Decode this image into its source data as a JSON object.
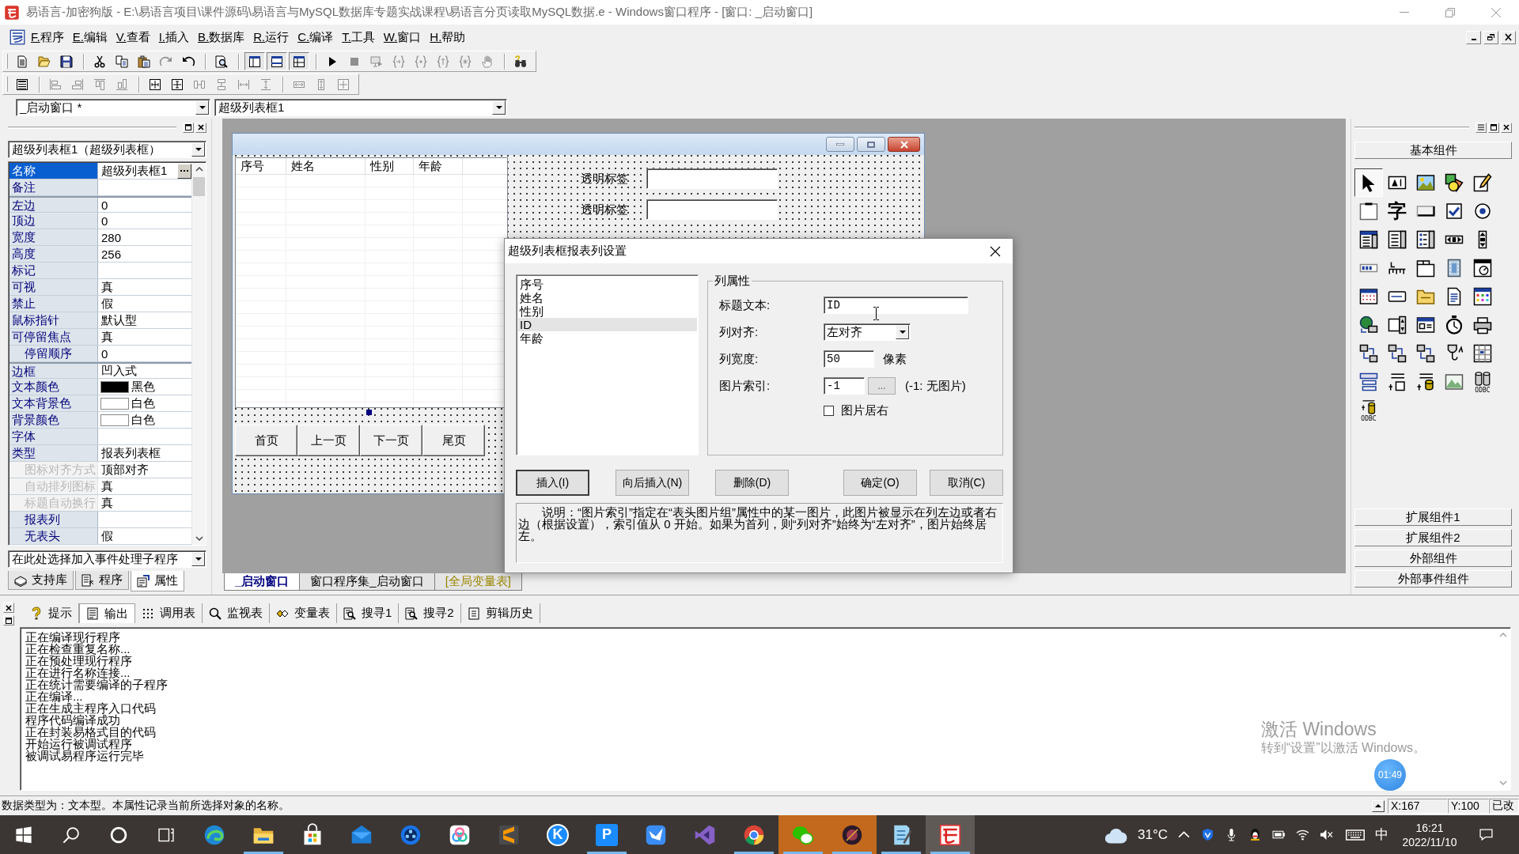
{
  "title_bar": {
    "title": "易语言-加密狗版 - E:\\易语言项目\\课件源码\\易语言与MySQL数据库专题实战课程\\易语言分页读取MySQL数据.e - Windows窗口程序 - [窗口: _启动窗口]"
  },
  "menu": [
    "F.程序",
    "E.编辑",
    "V.查看",
    "I.插入",
    "B.数据库",
    "R.运行",
    "C.编译",
    "T.工具",
    "W.窗口",
    "H.帮助"
  ],
  "toolbars": [
    {
      "groups": [
        {
          "buttons": [
            {
              "disabled": false,
              "pressed": false
            },
            {
              "disabled": false,
              "pressed": false
            },
            {
              "disabled": false,
              "pressed": false
            }
          ]
        },
        {
          "buttons": [
            {
              "disabled": false,
              "pressed": false
            },
            {
              "disabled": false,
              "pressed": false
            },
            {
              "disabled": false,
              "pressed": false
            },
            {
              "disabled": true,
              "pressed": false
            },
            {
              "disabled": false,
              "pressed": false
            }
          ]
        },
        {
          "buttons": [
            {
              "disabled": false,
              "pressed": false
            }
          ]
        },
        {
          "buttons": [
            {
              "disabled": false,
              "pressed": true
            },
            {
              "disabled": false,
              "pressed": true
            },
            {
              "disabled": false,
              "pressed": true
            }
          ]
        },
        {
          "buttons": [
            {
              "disabled": false,
              "pressed": false
            },
            {
              "disabled": true,
              "pressed": false
            },
            {
              "disabled": true,
              "pressed": false
            },
            {
              "disabled": true,
              "pressed": false
            },
            {
              "disabled": true,
              "pressed": false
            },
            {
              "disabled": true,
              "pressed": false
            },
            {
              "disabled": true,
              "pressed": false
            },
            {
              "disabled": true,
              "pressed": false
            }
          ]
        },
        {
          "buttons": [
            {
              "disabled": false,
              "pressed": false
            }
          ]
        }
      ]
    },
    {
      "groups": [
        {
          "buttons": [
            {
              "disabled": false,
              "pressed": false
            }
          ]
        },
        {
          "buttons": [
            {
              "disabled": true,
              "pressed": false
            },
            {
              "disabled": true,
              "pressed": false
            },
            {
              "disabled": true,
              "pressed": false
            },
            {
              "disabled": true,
              "pressed": false
            }
          ]
        },
        {
          "buttons": [
            {
              "disabled": false,
              "pressed": false
            },
            {
              "disabled": false,
              "pressed": false
            },
            {
              "disabled": true,
              "pressed": false
            },
            {
              "disabled": true,
              "pressed": false
            },
            {
              "disabled": true,
              "pressed": false
            },
            {
              "disabled": true,
              "pressed": false
            }
          ]
        },
        {
          "buttons": [
            {
              "disabled": true,
              "pressed": false
            },
            {
              "disabled": true,
              "pressed": false
            },
            {
              "disabled": true,
              "pressed": false
            }
          ]
        }
      ]
    }
  ],
  "selectors": {
    "window": "_启动窗口 *",
    "control": "超级列表框1"
  },
  "properties_panel": {
    "object": "超级列表框1（超级列表框）",
    "groups": [
      {
        "properties": [
          {
            "name": "名称",
            "value": "超级列表框1",
            "selected": true,
            "disabled": false
          },
          {
            "name": "备注",
            "selected": false,
            "disabled": false
          }
        ]
      },
      {
        "properties": [
          {
            "name": "左边",
            "value": "0",
            "selected": false,
            "disabled": false
          },
          {
            "name": "顶边",
            "value": "0",
            "selected": false,
            "disabled": false
          },
          {
            "name": "宽度",
            "value": "280",
            "selected": false,
            "disabled": false
          },
          {
            "name": "高度",
            "value": "256",
            "selected": false,
            "disabled": false
          },
          {
            "name": "标记",
            "selected": false,
            "disabled": false
          },
          {
            "name": "可视",
            "value": "真",
            "selected": false,
            "disabled": false
          },
          {
            "name": "禁止",
            "value": "假",
            "selected": false,
            "disabled": false
          },
          {
            "name": "鼠标指针",
            "value": "默认型",
            "selected": false,
            "disabled": false
          },
          {
            "name": "可停留焦点",
            "value": "真",
            "selected": false,
            "disabled": false,
            "children": [
              {
                "name": "停留顺序",
                "value": "0",
                "selected": false,
                "disabled": false
              }
            ]
          }
        ]
      },
      {
        "properties": [
          {
            "name": "边框",
            "value": "凹入式",
            "selected": false,
            "disabled": false
          },
          {
            "name": "文本颜色",
            "value": "黑色",
            "color": "#000000",
            "selected": false,
            "disabled": false
          },
          {
            "name": "文本背景色",
            "value": "白色",
            "color": "#ffffff",
            "selected": false,
            "disabled": false
          },
          {
            "name": "背景颜色",
            "value": "白色",
            "color": "#ffffff",
            "selected": false,
            "disabled": false
          },
          {
            "name": "字体",
            "selected": false,
            "disabled": false
          },
          {
            "name": "类型",
            "value": "报表列表框",
            "selected": false,
            "disabled": false,
            "children": [
              {
                "name": "图标对齐方式",
                "value": "顶部对齐",
                "selected": false,
                "disabled": true
              },
              {
                "name": "自动排列图标",
                "value": "真",
                "selected": false,
                "disabled": true
              },
              {
                "name": "标题自动换行",
                "value": "真",
                "selected": false,
                "disabled": true
              },
              {
                "name": "报表列",
                "selected": false,
                "disabled": false
              },
              {
                "name": "无表头",
                "value": "假",
                "selected": false,
                "disabled": false
              }
            ]
          }
        ]
      }
    ],
    "event_selector": "在此处选择加入事件处理子程序",
    "tabs": [
      {
        "label": "支持库",
        "selected": false
      },
      {
        "label": "程序",
        "selected": false
      },
      {
        "label": "属性",
        "selected": true
      }
    ]
  },
  "design": {
    "form": {
      "list_columns": [
        "序号",
        "姓名",
        "性别",
        "年龄"
      ],
      "fields": [
        {
          "label": "透明标签"
        },
        {
          "label": "透明标签"
        }
      ],
      "buttons": [
        "首页",
        "上一页",
        "下一页",
        "尾页"
      ]
    },
    "tabs": [
      {
        "label": "_启动窗口",
        "kind": "form",
        "selected": true
      },
      {
        "label": "窗口程序集_启动窗口",
        "kind": "module",
        "selected": false
      },
      {
        "label": "[全局变量表]",
        "kind": "globals",
        "selected": false
      }
    ]
  },
  "column_dialog": {
    "title": "超级列表框报表列设置",
    "columns": [
      {
        "label": "序号",
        "selected": false
      },
      {
        "label": "姓名",
        "selected": false
      },
      {
        "label": "性别",
        "selected": false
      },
      {
        "label": "ID",
        "selected": true
      },
      {
        "label": "年龄",
        "selected": false
      }
    ],
    "group_title": "列属性",
    "title_text": {
      "label": "标题文本:",
      "value": "ID"
    },
    "align": {
      "label": "列对齐:",
      "value": "左对齐"
    },
    "width": {
      "label": "列宽度:",
      "value": "50",
      "unit": "像素"
    },
    "image_index": {
      "label": "图片索引:",
      "value": "-1",
      "browse": "...",
      "hint": "(-1: 无图片)"
    },
    "image_right": {
      "label": "图片居右",
      "checked": false
    },
    "button_groups": [
      [
        {
          "label": "插入(I)",
          "default": true
        },
        {
          "label": "向后插入(N)",
          "default": false
        },
        {
          "label": "删除(D)",
          "default": false
        }
      ],
      [
        {
          "label": "确定(O)",
          "default": false
        },
        {
          "label": "取消(C)",
          "default": false
        }
      ]
    ],
    "note": "说明：“图片索引”指定在“表头图片组”属性中的某一图片，此图片被显示在列左边或者右边（根据设置），索引值从 0 开始。如果为首列，则“列对齐”始终为“左对齐”，图片始终居左。"
  },
  "component_palette": {
    "title": "基本组件",
    "tools": [
      {
        "selected": true
      },
      {
        "selected": false
      },
      {
        "selected": false
      },
      {
        "selected": false
      },
      {
        "selected": false
      },
      {
        "selected": false
      },
      {
        "selected": false,
        "glyph": "字"
      },
      {
        "selected": false
      },
      {
        "selected": false
      },
      {
        "selected": false
      },
      {
        "selected": false
      },
      {
        "selected": false
      },
      {
        "selected": false
      },
      {
        "selected": false
      },
      {
        "selected": false
      },
      {
        "selected": false
      },
      {
        "selected": false
      },
      {
        "selected": false
      },
      {
        "selected": false
      },
      {
        "selected": false
      },
      {
        "selected": false
      },
      {
        "selected": false
      },
      {
        "selected": false
      },
      {
        "selected": false
      },
      {
        "selected": false
      },
      {
        "selected": false
      },
      {
        "selected": false
      },
      {
        "selected": false
      },
      {
        "selected": false
      },
      {
        "selected": false
      },
      {
        "selected": false
      },
      {
        "selected": false
      },
      {
        "selected": false
      },
      {
        "selected": false
      },
      {
        "selected": false
      },
      {
        "selected": false
      },
      {
        "selected": false
      },
      {
        "selected": false
      },
      {
        "selected": false
      },
      {
        "selected": false,
        "glyph": "ODBC"
      },
      {
        "selected": false,
        "glyph": "ODBC"
      }
    ],
    "sections": [
      "扩展组件1",
      "扩展组件2",
      "外部组件",
      "外部事件组件"
    ]
  },
  "output": {
    "tabs": [
      {
        "label": "提示",
        "selected": false
      },
      {
        "label": "输出",
        "selected": true
      },
      {
        "label": "调用表",
        "selected": false
      },
      {
        "label": "监视表",
        "selected": false
      },
      {
        "label": "变量表",
        "selected": false
      },
      {
        "label": "搜寻1",
        "selected": false
      },
      {
        "label": "搜寻2",
        "selected": false
      },
      {
        "label": "剪辑历史",
        "selected": false
      }
    ],
    "lines": [
      "正在编译现行程序",
      "正在检查重复名称...",
      "正在预处理现行程序",
      "正在进行名称连接...",
      "正在统计需要编译的子程序",
      "正在编译...",
      "正在生成主程序入口代码",
      "程序代码编译成功",
      "正在封装易格式目的代码",
      "开始运行被调试程序",
      "被调试易程序运行完毕"
    ]
  },
  "activation_notice": {
    "title": "激活 Windows",
    "message": "转到“设置”以激活 Windows。"
  },
  "recorder_badge": "01:49",
  "status_bar": {
    "message": "数据类型为：文本型。本属性记录当前所选择对象的名称。",
    "x": "X:167",
    "y": "Y:100",
    "state": "已改"
  },
  "taskbar": {
    "apps": [
      {
        "running": false,
        "attention": false,
        "active": false
      },
      {
        "running": true,
        "attention": false,
        "active": false
      },
      {
        "running": false,
        "attention": false,
        "active": false
      },
      {
        "running": false,
        "attention": false,
        "active": false
      },
      {
        "running": false,
        "attention": false,
        "active": false
      },
      {
        "running": false,
        "attention": false,
        "active": false
      },
      {
        "running": false,
        "attention": false,
        "active": false
      },
      {
        "running": false,
        "attention": false,
        "active": false,
        "label": "K"
      },
      {
        "running": true,
        "attention": false,
        "active": false,
        "label": "P"
      },
      {
        "running": false,
        "attention": false,
        "active": false
      },
      {
        "running": false,
        "attention": false,
        "active": false
      },
      {
        "running": true,
        "attention": false,
        "active": false
      },
      {
        "running": true,
        "attention": true,
        "active": false
      },
      {
        "running": true,
        "attention": true,
        "active": false
      },
      {
        "running": true,
        "attention": false,
        "active": false
      },
      {
        "running": true,
        "attention": false,
        "active": true
      }
    ],
    "weather": "31°C",
    "ime": "中",
    "time": "16:21",
    "date": "2022/11/10"
  }
}
